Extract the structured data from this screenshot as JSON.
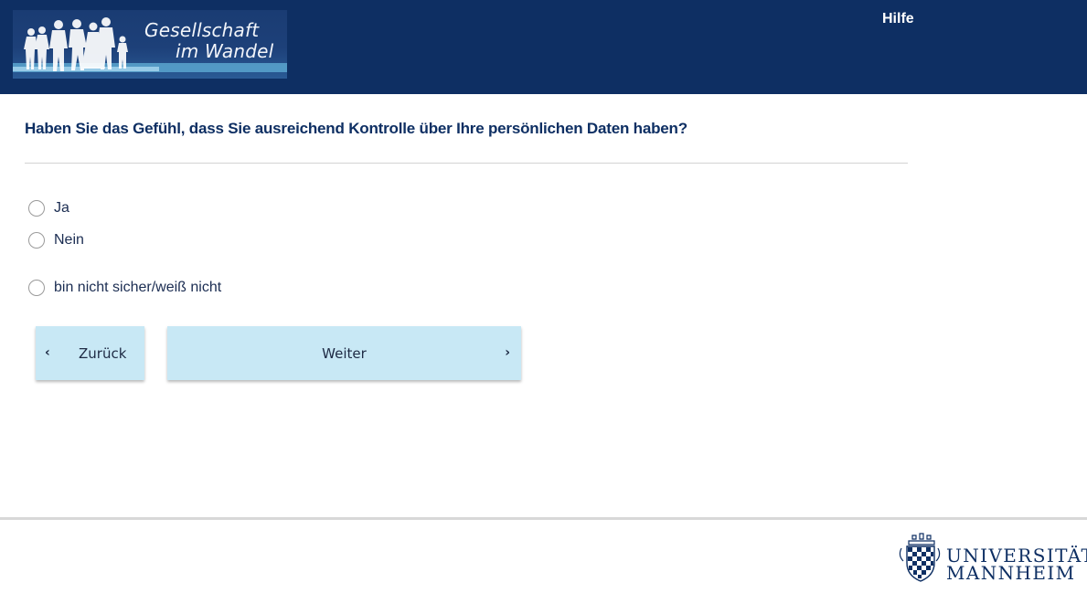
{
  "header": {
    "logo": {
      "line1": "Gesellschaft",
      "line2": "im Wandel"
    },
    "help_label": "Hilfe"
  },
  "question": {
    "text": "Haben Sie das Gefühl, dass Sie ausreichend Kontrolle über Ihre persönlichen Daten haben?",
    "options": [
      {
        "label": "Ja",
        "selected": false
      },
      {
        "label": "Nein",
        "selected": false
      },
      {
        "label": "bin nicht sicher/weiß nicht",
        "selected": false
      }
    ]
  },
  "navigation": {
    "back_label": "Zurück",
    "next_label": "Weiter",
    "back_icon": "chevron-left-icon",
    "next_icon": "chevron-right-icon"
  },
  "footer": {
    "university_line1": "UNIVERSITÄT",
    "university_line2": "MANNHEIM"
  },
  "colors": {
    "header_bg": "#0e2f63",
    "button_bg": "#c8e8f5",
    "question_text": "#0e2f63"
  }
}
